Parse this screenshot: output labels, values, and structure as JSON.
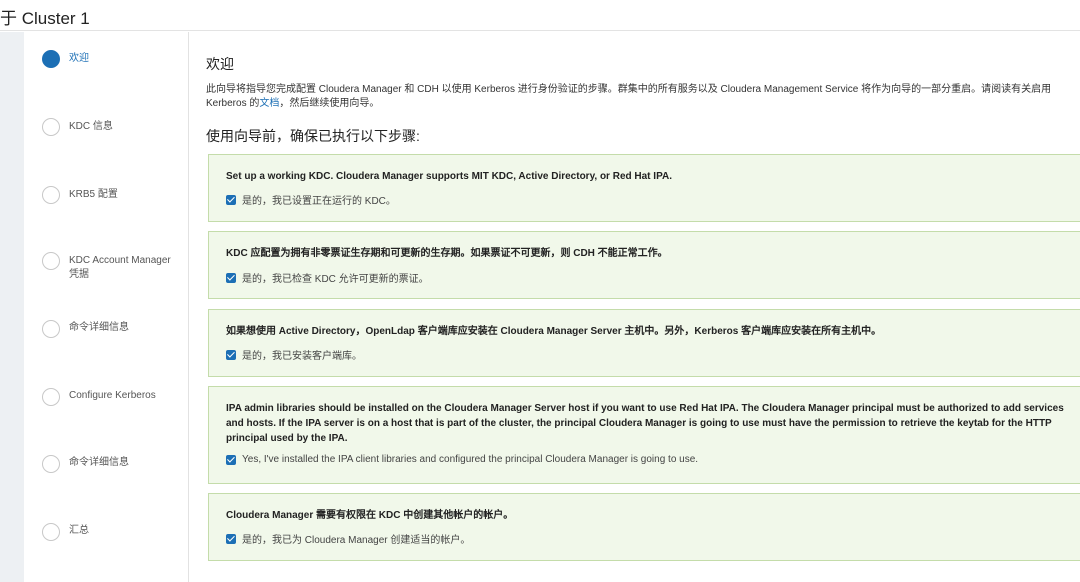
{
  "header": {
    "title": "于 Cluster 1"
  },
  "sidebar": {
    "steps": [
      {
        "label": "欢迎",
        "active": true
      },
      {
        "label": "KDC 信息",
        "active": false
      },
      {
        "label": "KRB5 配置",
        "active": false
      },
      {
        "label": "KDC Account Manager 凭据",
        "active": false
      },
      {
        "label": "命令详细信息",
        "active": false
      },
      {
        "label": "Configure Kerberos",
        "active": false
      },
      {
        "label": "命令详细信息",
        "active": false
      },
      {
        "label": "汇总",
        "active": false
      }
    ]
  },
  "main": {
    "title": "欢迎",
    "intro_before_link": "此向导将指导您完成配置 Cloudera Manager 和 CDH 以使用 Kerberos 进行身份验证的步骤。群集中的所有服务以及 Cloudera Management Service 将作为向导的一部分重启。请阅读有关启用 Kerberos 的",
    "intro_link": "文档",
    "intro_after_link": "，然后继续使用向导。",
    "subtitle": "使用向导前，确保已执行以下步骤:",
    "cards": [
      {
        "title": "Set up a working KDC. Cloudera Manager supports MIT KDC, Active Directory, or Red Hat IPA.",
        "check_label": "是的，我已设置正在运行的 KDC。",
        "checked": true
      },
      {
        "title": "KDC 应配置为拥有非零票证生存期和可更新的生存期。如果票证不可更新，则 CDH 不能正常工作。",
        "check_label": "是的，我已检查 KDC 允许可更新的票证。",
        "checked": true
      },
      {
        "title": "如果想使用 Active Directory，OpenLdap 客户端库应安装在 Cloudera Manager Server 主机中。另外，Kerberos 客户端库应安装在所有主机中。",
        "check_label": "是的，我已安装客户端库。",
        "checked": true
      },
      {
        "title": "IPA admin libraries should be installed on the Cloudera Manager Server host if you want to use Red Hat IPA. The Cloudera Manager principal must be authorized to add services and hosts. If the IPA server is on a host that is part of the cluster, the principal Cloudera Manager is going to use must have the permission to retrieve the keytab for the HTTP principal used by the IPA.",
        "check_label": "Yes, I've installed the IPA client libraries and configured the principal Cloudera Manager is going to use.",
        "checked": true
      },
      {
        "title": "Cloudera Manager 需要有权限在 KDC 中创建其他帐户的帐户。",
        "check_label": "是的，我已为 Cloudera Manager 创建适当的帐户。",
        "checked": true
      }
    ]
  },
  "colors": {
    "accent": "#1c6fb5",
    "card_bg": "#f1f8ea",
    "card_border": "#c4dcaa"
  }
}
